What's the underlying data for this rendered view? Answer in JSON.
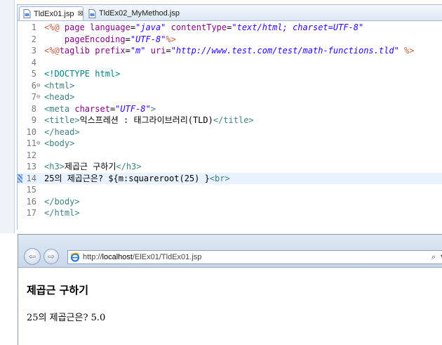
{
  "tabs": [
    {
      "label": "TldEx01.jsp",
      "close": "⊠"
    },
    {
      "label": "TldEx02_MyMethod.jsp"
    }
  ],
  "code_lines": [
    {
      "n": "1",
      "fold": "",
      "segs": [
        [
          "t-dir",
          "<%@ "
        ],
        [
          "t-attr",
          "page "
        ],
        [
          "t-attr",
          "language"
        ],
        [
          "t-text",
          "="
        ],
        [
          "t-val",
          "\"java\""
        ],
        [
          "t-text",
          " "
        ],
        [
          "t-attr",
          "contentType"
        ],
        [
          "t-text",
          "="
        ],
        [
          "t-val",
          "\"text/html; charset=UTF-8\""
        ]
      ]
    },
    {
      "n": "2",
      "fold": "",
      "segs": [
        [
          "t-text",
          "    "
        ],
        [
          "t-attr",
          "pageEncoding"
        ],
        [
          "t-text",
          "="
        ],
        [
          "t-val",
          "\"UTF-8\""
        ],
        [
          "t-dir",
          "%>"
        ]
      ]
    },
    {
      "n": "3",
      "fold": "",
      "segs": [
        [
          "t-dir",
          "<%@"
        ],
        [
          "t-attr",
          "taglib "
        ],
        [
          "t-attr",
          "prefix"
        ],
        [
          "t-text",
          "="
        ],
        [
          "t-val",
          "\"m\""
        ],
        [
          "t-text",
          " "
        ],
        [
          "t-attr",
          "uri"
        ],
        [
          "t-text",
          "="
        ],
        [
          "t-val",
          "\"http://www.test.com/test/math-functions.tld\""
        ],
        [
          "t-text",
          " "
        ],
        [
          "t-dir",
          "%>"
        ]
      ]
    },
    {
      "n": "4",
      "fold": "",
      "segs": []
    },
    {
      "n": "5",
      "fold": "",
      "segs": [
        [
          "t-doc",
          "<!DOCTYPE html>"
        ]
      ]
    },
    {
      "n": "6",
      "fold": "⊖",
      "segs": [
        [
          "t-tag",
          "<html>"
        ]
      ]
    },
    {
      "n": "7",
      "fold": "⊖",
      "segs": [
        [
          "t-tag",
          "<head>"
        ]
      ]
    },
    {
      "n": "8",
      "fold": "",
      "segs": [
        [
          "t-tag",
          "<meta "
        ],
        [
          "t-attr",
          "charset"
        ],
        [
          "t-text",
          "="
        ],
        [
          "t-val",
          "\"UTF-8\""
        ],
        [
          "t-tag",
          ">"
        ]
      ]
    },
    {
      "n": "9",
      "fold": "",
      "segs": [
        [
          "t-tag",
          "<title>"
        ],
        [
          "t-text",
          "익스프레션 : 태그라이브러리(TLD)"
        ],
        [
          "t-tag",
          "</title>"
        ]
      ]
    },
    {
      "n": "10",
      "fold": "",
      "segs": [
        [
          "t-tag",
          "</head>"
        ]
      ]
    },
    {
      "n": "11",
      "fold": "⊖",
      "segs": [
        [
          "t-tag",
          "<body>"
        ]
      ]
    },
    {
      "n": "12",
      "fold": "",
      "segs": []
    },
    {
      "n": "13",
      "fold": "",
      "segs": [
        [
          "t-tag",
          "<h3>"
        ],
        [
          "t-text",
          "제곱근 구하기"
        ],
        [
          "t-tag",
          "</h3>"
        ]
      ]
    },
    {
      "n": "14",
      "fold": "",
      "cur": true,
      "segs": [
        [
          "t-text",
          "25의 제곱근은? ${m:squareroot(25) }"
        ],
        [
          "t-tag",
          "<br>"
        ]
      ]
    },
    {
      "n": "15",
      "fold": "",
      "segs": []
    },
    {
      "n": "16",
      "fold": "",
      "segs": [
        [
          "t-tag",
          "</body>"
        ]
      ]
    },
    {
      "n": "17",
      "fold": "",
      "segs": [
        [
          "t-tag",
          "</html>"
        ]
      ]
    }
  ],
  "browser": {
    "back_label": "⇦",
    "forward_label": "⇨",
    "url_prefix": "http://",
    "url_host": "localhost",
    "url_path": "/ElEx01/TldEx01.jsp",
    "search_icon": "⌕",
    "dropdown_icon": "▾",
    "page_heading": "제곱근 구하기",
    "page_text": "25의 제곱근은? 5.0"
  },
  "icons": {
    "file": "jsp-file-icon",
    "browser": "ie-icon"
  }
}
